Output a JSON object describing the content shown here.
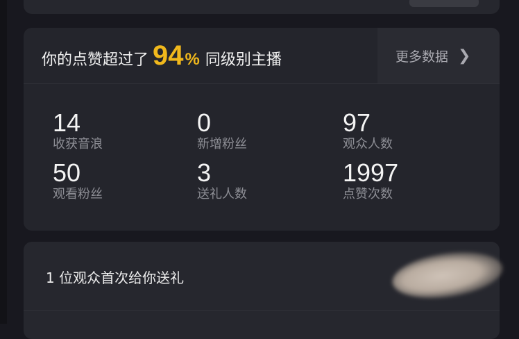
{
  "headline": {
    "prefix": "你的点赞超过了",
    "percent_value": "94",
    "percent_sign": "%",
    "suffix": "同级别主播"
  },
  "more_link": {
    "label": "更多数据",
    "icon": "chevron-right-icon"
  },
  "stats": [
    {
      "value": "14",
      "label": "收获音浪"
    },
    {
      "value": "0",
      "label": "新增粉丝"
    },
    {
      "value": "97",
      "label": "观众人数"
    },
    {
      "value": "50",
      "label": "观看粉丝"
    },
    {
      "value": "3",
      "label": "送礼人数"
    },
    {
      "value": "1997",
      "label": "点赞次数"
    }
  ],
  "gift": {
    "text": "1 位观众首次给你送礼"
  },
  "colors": {
    "accent": "#f0b81c",
    "background": "#18181f",
    "card": "#24252c"
  }
}
